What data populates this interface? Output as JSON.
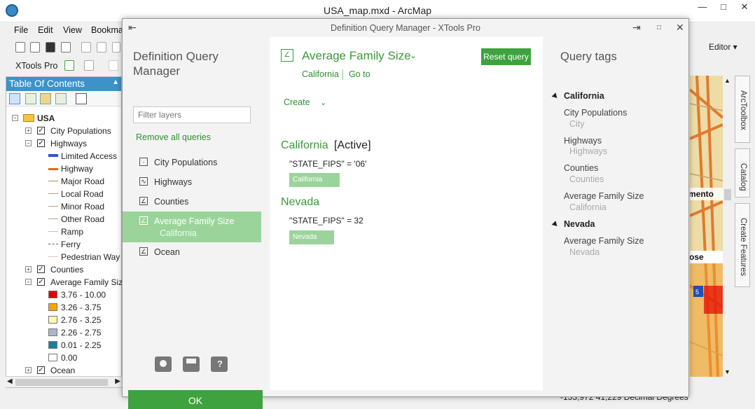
{
  "arcmap": {
    "title": "USA_map.mxd - ArcMap",
    "menu": [
      "File",
      "Edit",
      "View",
      "Bookmarks"
    ],
    "toolbar_xtools_label": "XTools Pro",
    "editor_label": "Editor ▾",
    "status_coords": "-133,972  41,229 Decimal Degrees",
    "side_tabs": [
      "ArcToolbox",
      "Catalog",
      "Create Features"
    ]
  },
  "toc": {
    "title": "Table Of Contents",
    "root": "USA",
    "layers": [
      {
        "name": "City Populations",
        "checked": true,
        "expanded": false
      },
      {
        "name": "Highways",
        "checked": true,
        "expanded": true
      },
      {
        "name": "Counties",
        "checked": true,
        "expanded": false
      },
      {
        "name": "Average Family Size",
        "checked": true,
        "expanded": true
      },
      {
        "name": "Ocean",
        "checked": true,
        "expanded": false
      }
    ],
    "highway_classes": [
      {
        "label": "Limited Access",
        "color": "#2b57c8",
        "style": "double"
      },
      {
        "label": "Highway",
        "color": "#e8641e",
        "style": "thick"
      },
      {
        "label": "Major Road",
        "color": "#c8835a",
        "style": "thin"
      },
      {
        "label": "Local Road",
        "color": "#c89878",
        "style": "thin"
      },
      {
        "label": "Minor Road",
        "color": "#b8a090",
        "style": "thin"
      },
      {
        "label": "Other Road",
        "color": "#c0a080",
        "style": "thin"
      },
      {
        "label": "Ramp",
        "color": "#d0c0b0",
        "style": "thin"
      },
      {
        "label": "Ferry",
        "color": "#2a6b8a",
        "style": "dashed"
      },
      {
        "label": "Pedestrian Way",
        "color": "#d8c8b8",
        "style": "thin"
      }
    ],
    "family_classes": [
      {
        "label": "3.76 - 10.00",
        "color": "#e60000"
      },
      {
        "label": "3.26 - 3.75",
        "color": "#f5a500"
      },
      {
        "label": "2.76 - 3.25",
        "color": "#fcf5b8"
      },
      {
        "label": "2.26 - 2.75",
        "color": "#a8b8cc"
      },
      {
        "label": "0.01 - 2.25",
        "color": "#1a80a0"
      },
      {
        "label": "0.00",
        "color": "#ffffff"
      }
    ]
  },
  "dialog": {
    "title": "Definition Query Manager - XTools Pro",
    "heading": "Definition Query Manager",
    "filter_placeholder": "Filter layers",
    "remove_all_label": "Remove all queries",
    "layers": [
      {
        "name": "City Populations",
        "icon": "point-layer-icon",
        "sub": ""
      },
      {
        "name": "Highways",
        "icon": "line-layer-icon",
        "sub": ""
      },
      {
        "name": "Counties",
        "icon": "polygon-layer-icon",
        "sub": ""
      },
      {
        "name": "Average Family Size",
        "icon": "polygon-layer-icon",
        "sub": "California",
        "selected": true
      },
      {
        "name": "Ocean",
        "icon": "polygon-layer-icon",
        "sub": ""
      }
    ],
    "ok_label": "OK",
    "accent_color": "#3ea23e",
    "selected_color": "#9bd49b"
  },
  "editor": {
    "layer_title": "Average Family Size",
    "reset_label": "Reset query",
    "link_state": "California",
    "link_goto": "Go to",
    "create_label": "Create",
    "queries": [
      {
        "name": "California",
        "active_label": "[Active]",
        "expression": "\"STATE_FIPS\" = '06'",
        "tag": "California"
      },
      {
        "name": "Nevada",
        "active_label": "",
        "expression": "\"STATE_FIPS\" = 32",
        "tag": "Nevada"
      }
    ]
  },
  "tags": {
    "heading": "Query tags",
    "groups": [
      {
        "name": "California",
        "items": [
          {
            "layer": "City Populations",
            "value": "City"
          },
          {
            "layer": "Highways",
            "value": "Highways"
          },
          {
            "layer": "Counties",
            "value": "Counties"
          },
          {
            "layer": "Average Family Size",
            "value": "California"
          }
        ]
      },
      {
        "name": "Nevada",
        "items": [
          {
            "layer": "Average Family Size",
            "value": "Nevada"
          }
        ]
      }
    ]
  }
}
